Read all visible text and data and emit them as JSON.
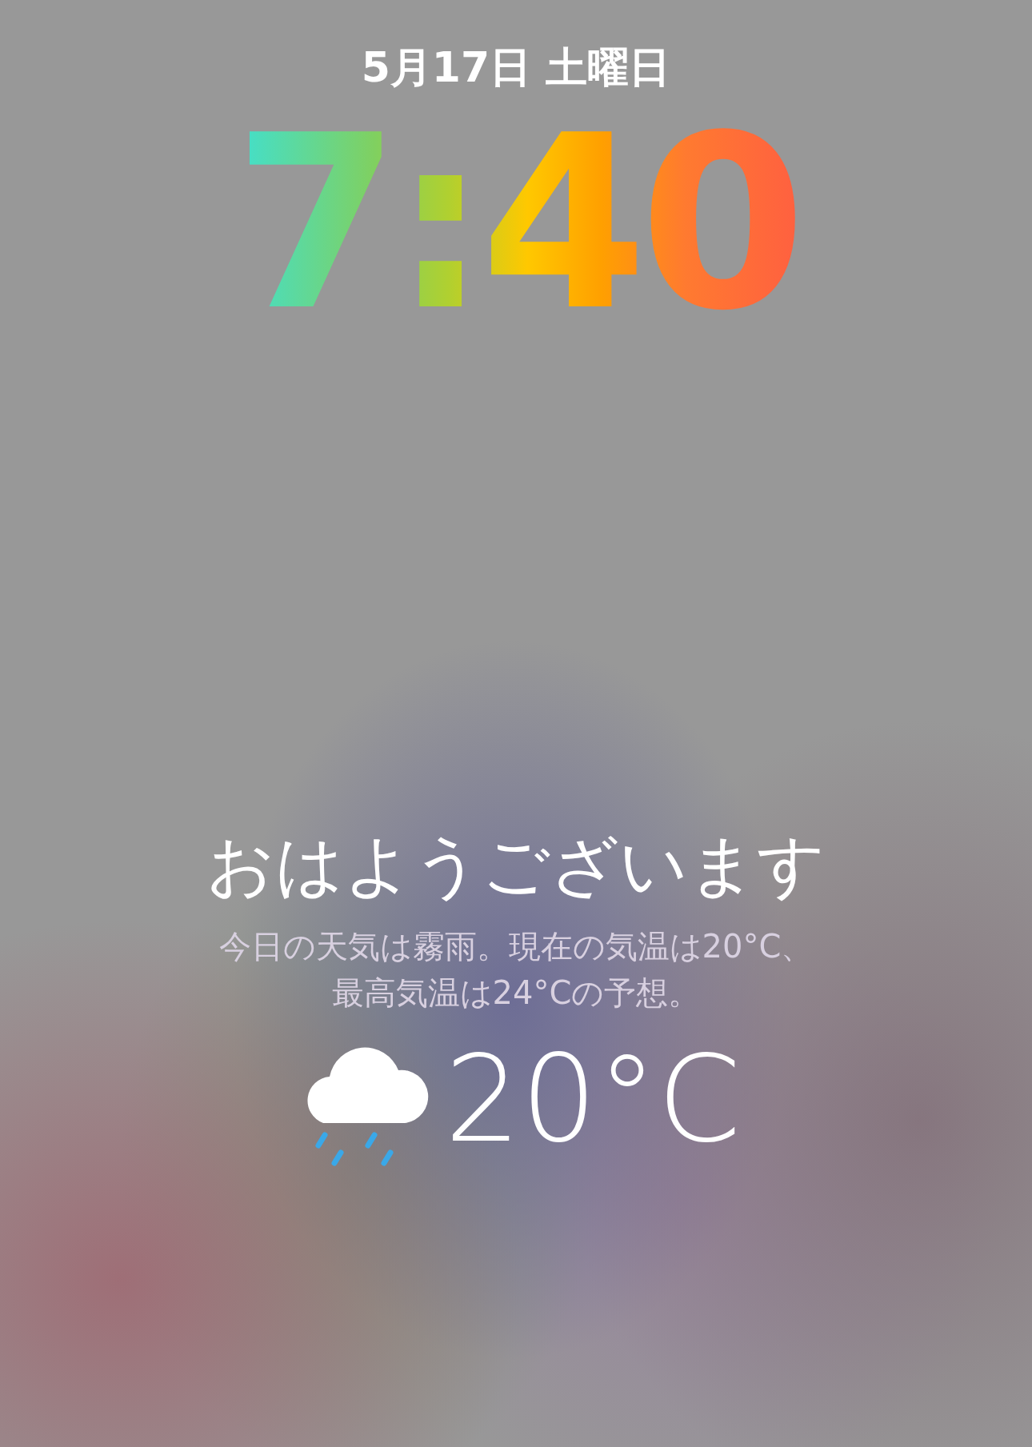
{
  "date": "5月17日 土曜日",
  "time": "7:40",
  "greeting": "おはようございます",
  "forecast": [
    "今日の天気は霧雨。現在の気温は20°C、",
    "最高気温は24°Cの予想。"
  ],
  "weather": {
    "kind": "rain",
    "temperature": "20°C"
  }
}
